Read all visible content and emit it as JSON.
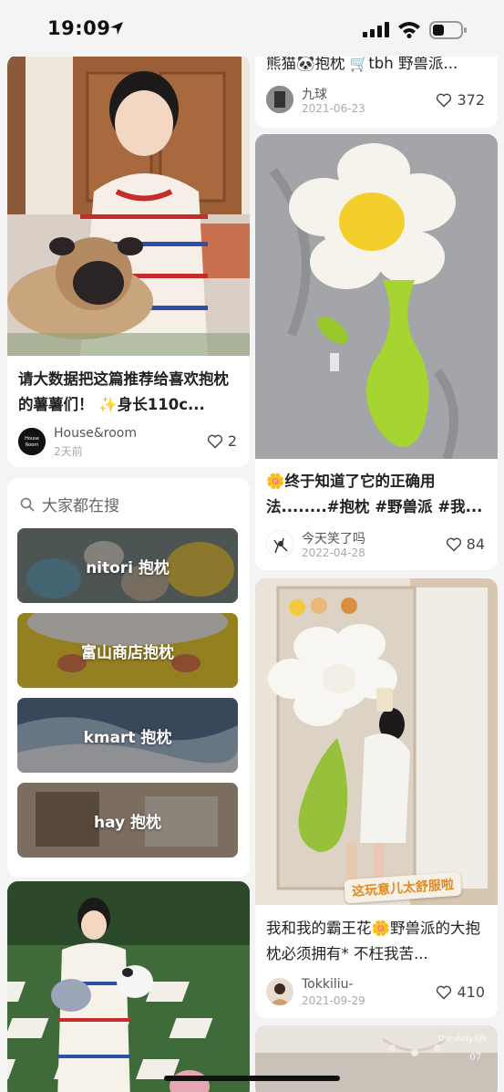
{
  "status": {
    "time": "19:09"
  },
  "left": {
    "card1": {
      "title": "请大数据把这篇推荐给喜欢抱枕的薯薯们！ ✨身长110c...",
      "user": "House&room",
      "date": "2天前",
      "likes": "2",
      "avatar_text": "House Room"
    },
    "search": {
      "heading": "大家都在搜",
      "items": [
        "nitori 抱枕",
        "富山商店抱枕",
        "kmart 抱枕",
        "hay 抱枕"
      ]
    }
  },
  "right": {
    "card0": {
      "title": "熊猫🐼抱枕 🛒tbh 野兽派...",
      "user": "九球",
      "date": "2021-06-23",
      "likes": "372"
    },
    "card1": {
      "title": "🌼终于知道了它的正确用法........#抱枕 #野兽派 #我...",
      "user": "今天笑了吗",
      "date": "2022-04-28",
      "likes": "84"
    },
    "card2": {
      "sticker": "这玩意儿太舒服啦",
      "title": "我和我的霸王花🌼野兽派的大抱枕必须拥有* 不枉我苦...",
      "user": "Tokkiliu-",
      "date": "2021-09-29",
      "likes": "410"
    },
    "card3": {
      "overlay_text": "Our daily life",
      "overlay_num": "07"
    }
  },
  "colors": {
    "accent": "#ff2442",
    "flower_green": "#a6d431",
    "flower_yellow": "#f4d22a"
  }
}
